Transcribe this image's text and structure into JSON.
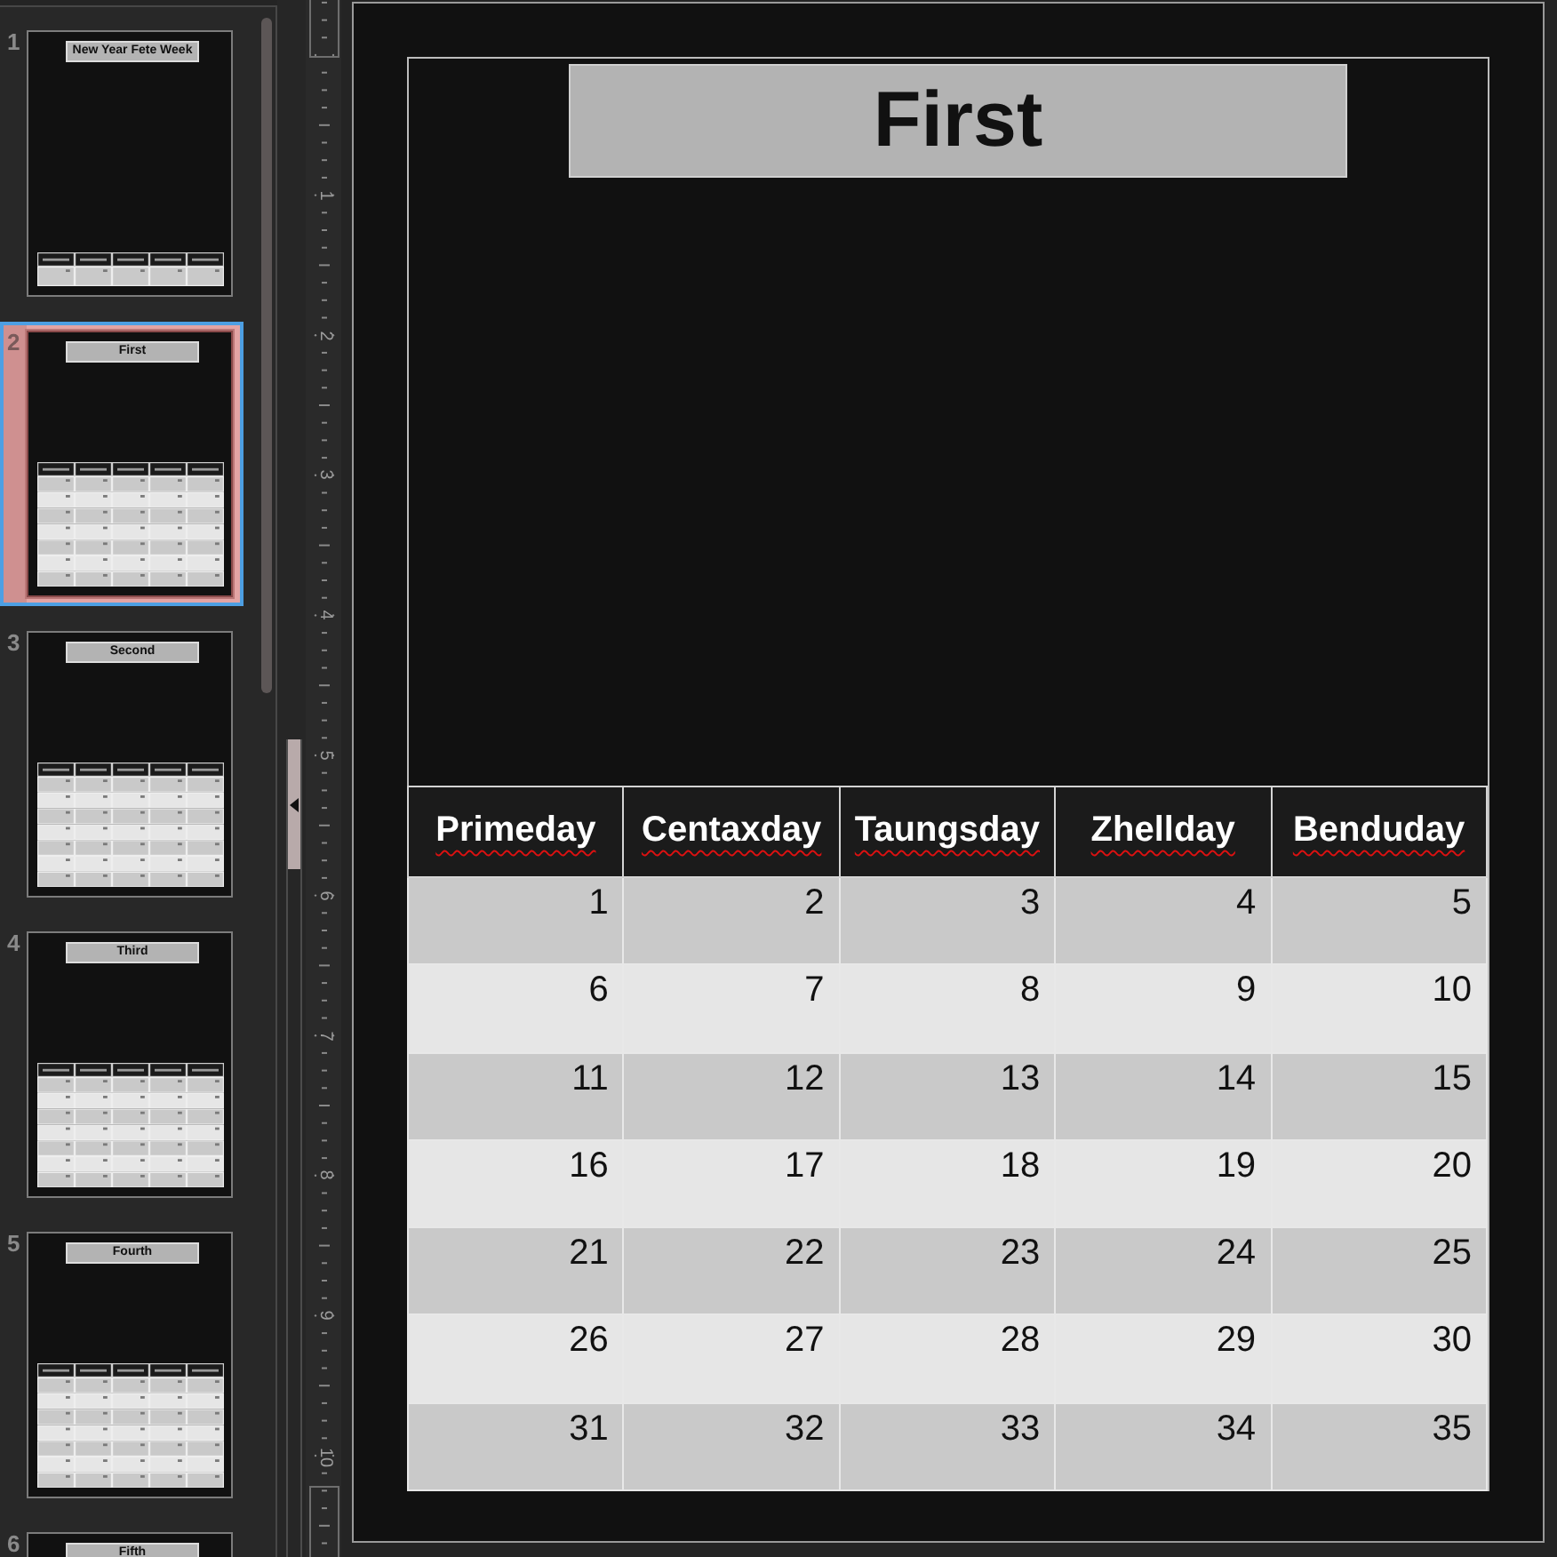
{
  "slide_panel": {
    "slides": [
      {
        "number": "1",
        "title": "New Year Fete Week",
        "kind": "week",
        "selected": false
      },
      {
        "number": "2",
        "title": "First",
        "kind": "month",
        "selected": true
      },
      {
        "number": "3",
        "title": "Second",
        "kind": "month",
        "selected": false
      },
      {
        "number": "4",
        "title": "Third",
        "kind": "month",
        "selected": false
      },
      {
        "number": "5",
        "title": "Fourth",
        "kind": "month",
        "selected": false
      },
      {
        "number": "6",
        "title": "Fifth",
        "selected": false
      }
    ]
  },
  "ruler": {
    "marks": [
      "1",
      "2",
      "3",
      "4",
      "5",
      "6",
      "7",
      "8",
      "9",
      "10"
    ]
  },
  "slide": {
    "title": "First",
    "table": {
      "columns": [
        {
          "label": "Primeday",
          "misspelled": true
        },
        {
          "label": "Centaxday",
          "misspelled": true
        },
        {
          "label": "Taungsday",
          "misspelled": true
        },
        {
          "label": "Zhellday",
          "misspelled": true
        },
        {
          "label": "Benduday",
          "misspelled": true
        }
      ],
      "rows": [
        [
          "1",
          "2",
          "3",
          "4",
          "5"
        ],
        [
          "6",
          "7",
          "8",
          "9",
          "10"
        ],
        [
          "11",
          "12",
          "13",
          "14",
          "15"
        ],
        [
          "16",
          "17",
          "18",
          "19",
          "20"
        ],
        [
          "21",
          "22",
          "23",
          "24",
          "25"
        ],
        [
          "26",
          "27",
          "28",
          "29",
          "30"
        ],
        [
          "31",
          "32",
          "33",
          "34",
          "35"
        ]
      ]
    }
  }
}
